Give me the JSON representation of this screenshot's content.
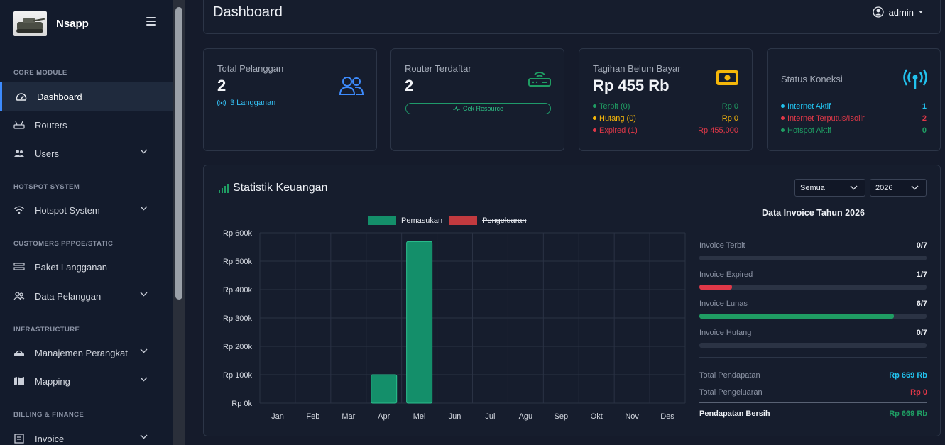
{
  "brand": {
    "name": "Nsapp"
  },
  "sidebar": {
    "sections": [
      "CORE MODULE",
      "HOTSPOT SYSTEM",
      "CUSTOMERS PPPOE/STATIC",
      "INFRASTRUCTURE",
      "BILLING & FINANCE"
    ],
    "items": [
      {
        "label": "Dashboard",
        "icon": "dashboard-gauge-icon",
        "active": true
      },
      {
        "label": "Routers",
        "icon": "router-icon"
      },
      {
        "label": "Users",
        "icon": "users-icon",
        "has_submenu": true
      },
      {
        "label": "Hotspot System",
        "icon": "wifi-icon",
        "has_submenu": true
      },
      {
        "label": "Paket Langganan",
        "icon": "list-icon"
      },
      {
        "label": "Data Pelanggan",
        "icon": "customers-icon",
        "has_submenu": true
      },
      {
        "label": "Manajemen Perangkat",
        "icon": "devices-icon",
        "has_submenu": true
      },
      {
        "label": "Mapping",
        "icon": "map-icon",
        "has_submenu": true
      },
      {
        "label": "Invoice",
        "icon": "invoice-icon",
        "has_submenu": true
      }
    ]
  },
  "header": {
    "title": "Dashboard",
    "user": "admin"
  },
  "cards": {
    "pelanggan": {
      "label": "Total Pelanggan",
      "value": "2",
      "link": "3 Langganan"
    },
    "router": {
      "label": "Router Terdaftar",
      "value": "2",
      "button": "Cek Resource"
    },
    "tagihan": {
      "label": "Tagihan Belum Bayar",
      "value": "Rp 455 Rb",
      "rows": [
        {
          "label": "Terbit (0)",
          "amount": "Rp 0",
          "color": "#1f9d63"
        },
        {
          "label": "Hutang (0)",
          "amount": "Rp 0",
          "color": "#f5b70a"
        },
        {
          "label": "Expired (1)",
          "amount": "Rp 455,000",
          "color": "#e03848"
        }
      ]
    },
    "koneksi": {
      "label": "Status Koneksi",
      "rows": [
        {
          "label": "Internet Aktif",
          "count": "1",
          "color": "#22c2ee"
        },
        {
          "label": "Internet Terputus/Isolir",
          "count": "2",
          "color": "#e03848"
        },
        {
          "label": "Hotspot Aktif",
          "count": "0",
          "color": "#1f9d63"
        }
      ]
    }
  },
  "stats": {
    "title": "Statistik Keuangan",
    "filter_type": "Semua",
    "filter_year": "2026"
  },
  "chart_data": {
    "type": "bar",
    "categories": [
      "Jan",
      "Feb",
      "Mar",
      "Apr",
      "Mei",
      "Jun",
      "Jul",
      "Agu",
      "Sep",
      "Okt",
      "Nov",
      "Des"
    ],
    "series": [
      {
        "name": "Pemasukan",
        "color": "#148f6a",
        "values": [
          0,
          0,
          0,
          100000,
          569000,
          0,
          0,
          0,
          0,
          0,
          0,
          0
        ]
      },
      {
        "name": "Pengeluaran",
        "color": "#c23a3f",
        "hidden": true,
        "values": [
          0,
          0,
          0,
          0,
          0,
          0,
          0,
          0,
          0,
          0,
          0,
          0
        ]
      }
    ],
    "ylim": [
      0,
      600000
    ],
    "yticks": [
      "Rp 0k",
      "Rp 100k",
      "Rp 200k",
      "Rp 300k",
      "Rp 400k",
      "Rp 500k",
      "Rp 600k"
    ],
    "legend": "top-center",
    "grid": true
  },
  "invoice": {
    "title": "Data Invoice Tahun 2026",
    "rows": [
      {
        "label": "Invoice Terbit",
        "count": "0/7",
        "fraction": 0,
        "color": "#1f9d63"
      },
      {
        "label": "Invoice Expired",
        "count": "1/7",
        "fraction": 0.143,
        "color": "#e03848"
      },
      {
        "label": "Invoice Lunas",
        "count": "6/7",
        "fraction": 0.857,
        "color": "#1f9d63"
      },
      {
        "label": "Invoice Hutang",
        "count": "0/7",
        "fraction": 0,
        "color": "#f5b70a"
      }
    ],
    "totals": [
      {
        "label": "Total Pendapatan",
        "value": "Rp 669 Rb",
        "color": "#22c2ee"
      },
      {
        "label": "Total Pengeluaran",
        "value": "Rp 0",
        "color": "#e03848"
      },
      {
        "label": "Pendapatan Bersih",
        "value": "Rp 669 Rb",
        "color": "#1f9d63"
      }
    ]
  }
}
